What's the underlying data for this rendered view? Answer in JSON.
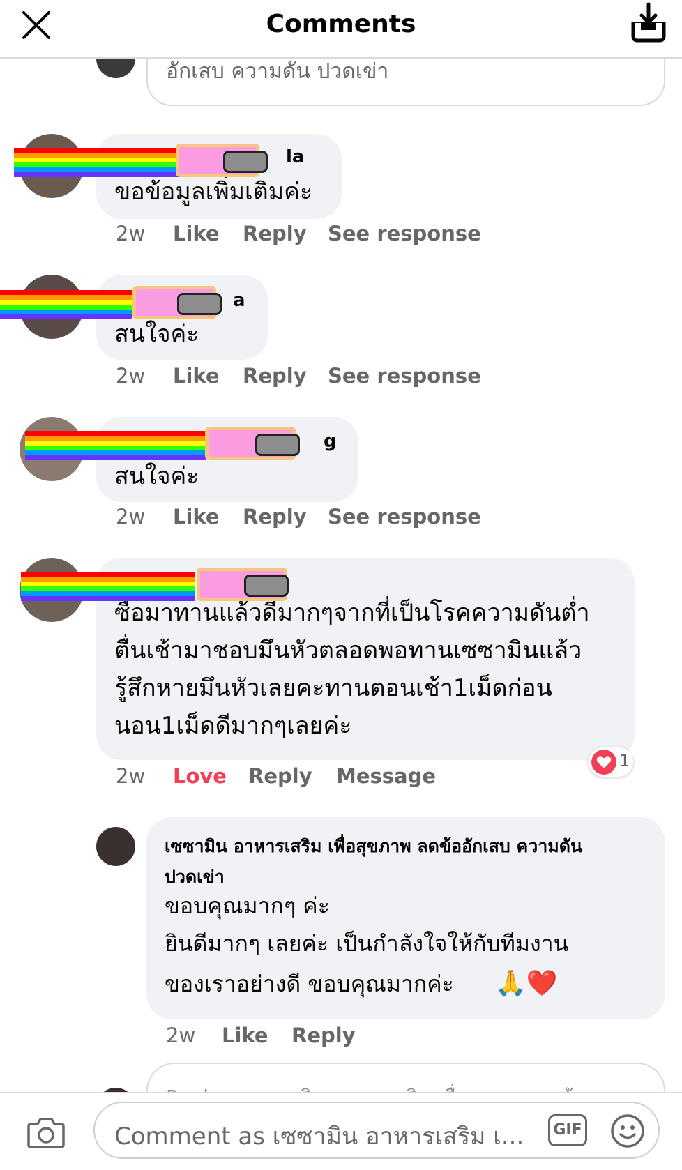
{
  "header": {
    "title": "Comments"
  },
  "top_reply": {
    "text": "อักเสบ ความดัน ปวดเข่า"
  },
  "comments": [
    {
      "name": "la",
      "text": "ขอข้อมูลเพิ่มเติมค่ะ",
      "time": "2w",
      "like": "Like",
      "reply": "Reply",
      "see": "See response"
    },
    {
      "name": "a",
      "text": "สนใจค่ะ",
      "time": "2w",
      "like": "Like",
      "reply": "Reply",
      "see": "See response"
    },
    {
      "name": "g",
      "text": "สนใจค่ะ",
      "time": "2w",
      "like": "Like",
      "reply": "Reply",
      "see": "See response"
    },
    {
      "lines": [
        "ซื้อมาทานแล้วดีมากๆจากที่เป็นโรคความดันต่ำ",
        "ตื่นเช้ามาชอบมึนหัวตลอดพอทานเซซามินแล้ว",
        "รู้สึกหายมึนหัวเลยคะทานตอนเช้า1เม็ดก่อน",
        "นอน1เม็ดดีมากๆเลยค่ะ"
      ],
      "time": "2w",
      "love": "Love",
      "reply": "Reply",
      "message": "Message",
      "reaction_count": "1"
    }
  ],
  "page_reply": {
    "name_line1": "เซซามิน อาหารเสริม เพื่อสุขภาพ ลดข้ออักเสบ ความดัน",
    "name_line2": "ปวดเข่า",
    "line1": "ขอบคุณมากๆ ค่ะ",
    "line2": "ยินดีมากๆ เลยค่ะ  เป็นกำลังใจให้กับทีมงาน",
    "line3": "ของเราอย่างดี ขอบคุณมากค่ะ",
    "emoji": "🙏❤️",
    "time": "2w",
    "like": "Like",
    "reply": "Reply"
  },
  "reply_box": {
    "placeholder": "Reply as เซซามิน อาหารเสริม เพื่อสุขภาพ ลดข้อ..."
  },
  "composer": {
    "placeholder": "Comment as เซซามิน อาหารเสริม เ...",
    "gif_label": "GIF"
  },
  "colors": {
    "love": "#f33e58",
    "bubble": "#f0f2f5",
    "secondary_text": "#65676b"
  }
}
